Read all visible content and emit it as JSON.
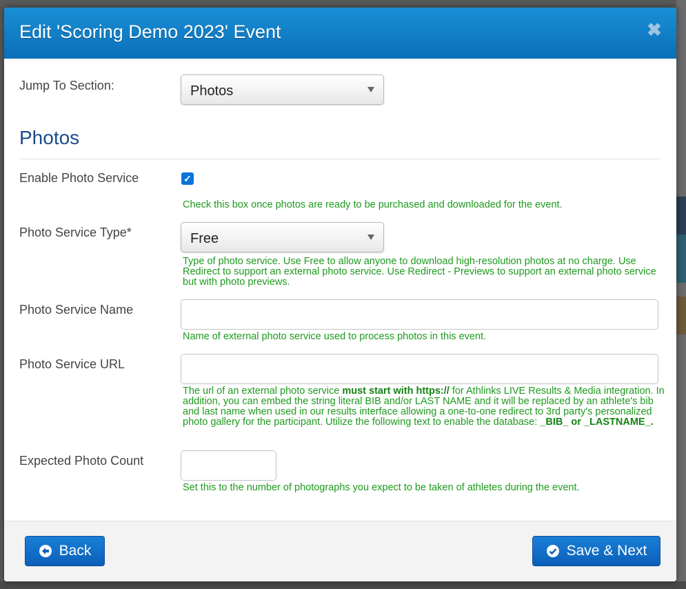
{
  "modal": {
    "title": "Edit 'Scoring Demo 2023' Event",
    "close_icon": "close-icon"
  },
  "jump": {
    "label": "Jump To Section:",
    "value": "Photos"
  },
  "section": {
    "title": "Photos"
  },
  "enable_photo": {
    "label": "Enable Photo Service",
    "checked": true,
    "help": "Check this box once photos are ready to be purchased and downloaded for the event."
  },
  "service_type": {
    "label": "Photo Service Type*",
    "value": "Free",
    "help": "Type of photo service. Use Free to allow anyone to download high-resolution photos at no charge. Use Redirect to support an external photo service. Use Redirect - Previews to support an external photo service but with photo previews."
  },
  "service_name": {
    "label": "Photo Service Name",
    "value": "",
    "help": "Name of external photo service used to process photos in this event."
  },
  "service_url": {
    "label": "Photo Service URL",
    "value": "",
    "help_pre": "The url of an external photo service ",
    "help_bold": "must start with https://",
    "help_mid": " for Athlinks LIVE Results & Media integration. In addition, you can embed the string literal BIB and/or LAST NAME and it will be replaced by an athlete's bib and last name when used in our results interface allowing a one-to-one redirect to 3rd party's personalized photo gallery for the participant. Utilize the following text to enable the database: ",
    "help_bold2": "_BIB_ or _LASTNAME_."
  },
  "photo_count": {
    "label": "Expected Photo Count",
    "value": "",
    "help": "Set this to the number of photographs you expect to be taken of athletes during the event."
  },
  "footer": {
    "back_label": "Back",
    "back_icon": "arrow-left-icon",
    "next_label": "Save & Next",
    "next_icon": "check-circle-icon"
  },
  "colors": {
    "header": "#0a6fb8",
    "help_text": "#1e9a1e",
    "section_title": "#1a4a8a",
    "button": "#0b5fb8"
  }
}
